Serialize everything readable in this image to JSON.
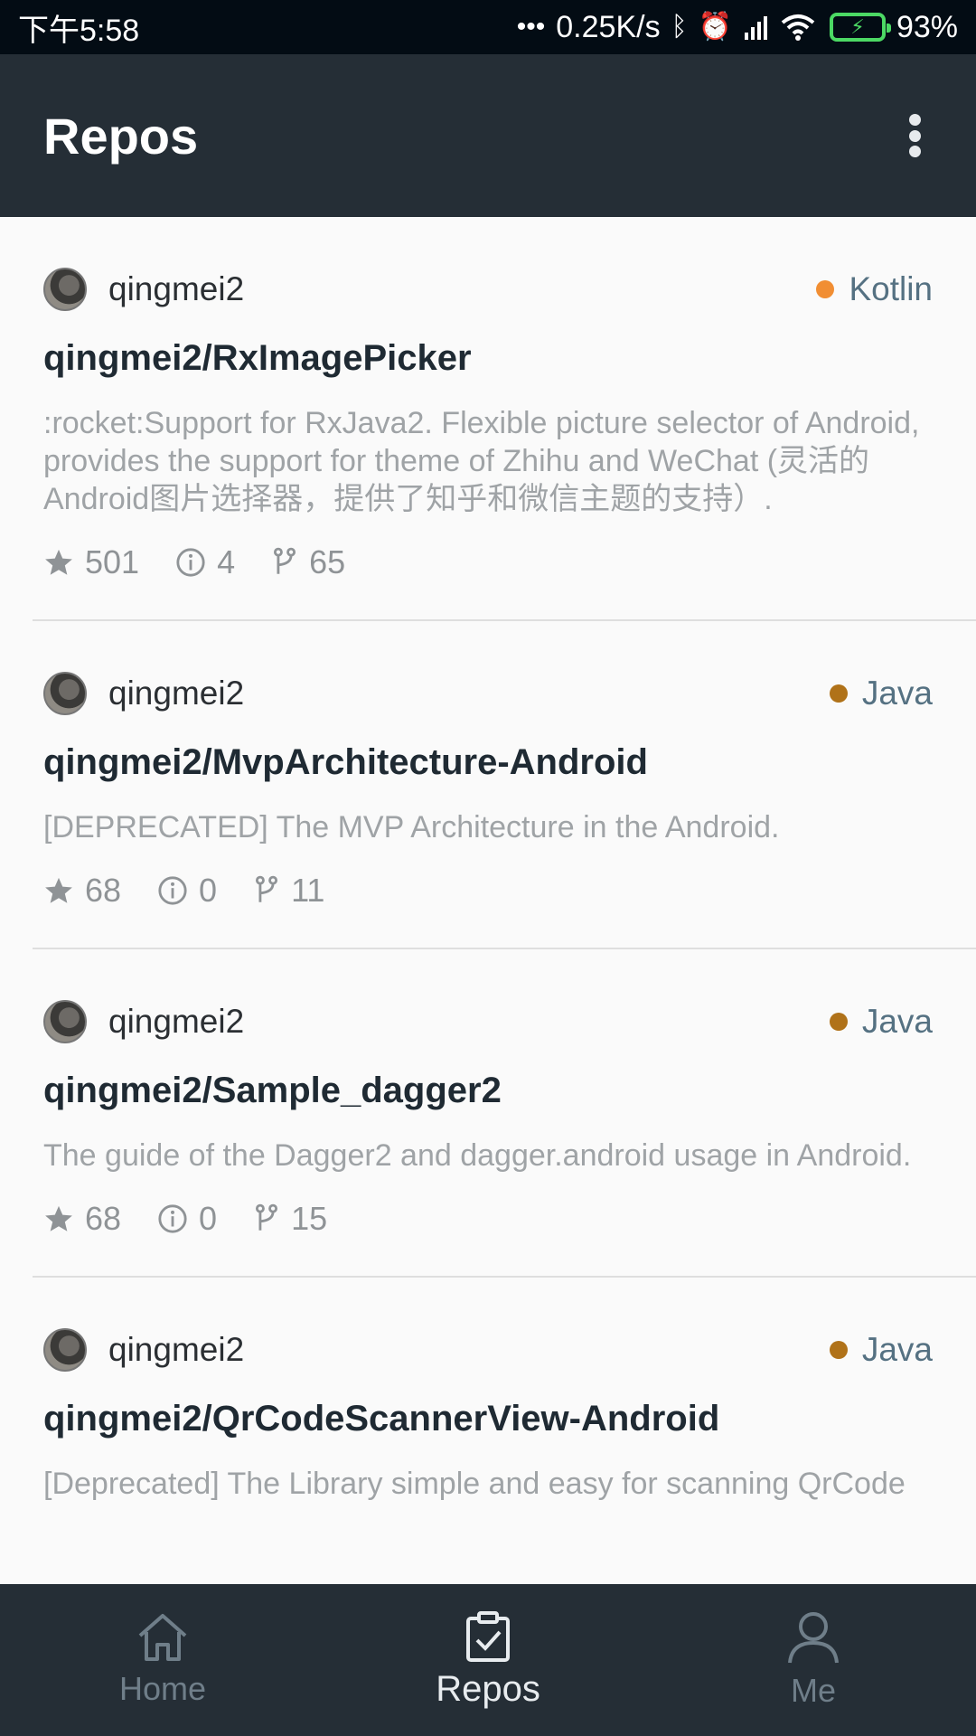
{
  "status_bar": {
    "time": "下午5:58",
    "net_speed": "0.25K/s",
    "battery": "93%",
    "icons": [
      "dots-icon",
      "bluetooth-icon",
      "alarm-icon",
      "signal-icon",
      "wifi-icon",
      "battery-icon"
    ]
  },
  "app_bar": {
    "title": "Repos",
    "menu_icon": "more-vert-icon"
  },
  "repos": [
    {
      "owner": "qingmei2",
      "language": "Kotlin",
      "language_color": "#f18e33",
      "name": "qingmei2/RxImagePicker",
      "description": ":rocket:Support for RxJava2. Flexible picture selector of Android, provides the support for theme of Zhihu and WeChat (灵活的Android图片选择器，提供了知乎和微信主题的支持）.",
      "stars": "501",
      "issues": "4",
      "forks": "65"
    },
    {
      "owner": "qingmei2",
      "language": "Java",
      "language_color": "#b07219",
      "name": "qingmei2/MvpArchitecture-Android",
      "description": "[DEPRECATED] The MVP Architecture in the Android.",
      "stars": "68",
      "issues": "0",
      "forks": "11"
    },
    {
      "owner": "qingmei2",
      "language": "Java",
      "language_color": "#b07219",
      "name": "qingmei2/Sample_dagger2",
      "description": "The guide of the Dagger2 and dagger.android usage in Android.",
      "stars": "68",
      "issues": "0",
      "forks": "15"
    },
    {
      "owner": "qingmei2",
      "language": "Java",
      "language_color": "#b07219",
      "name": "qingmei2/QrCodeScannerView-Android",
      "description": "[Deprecated] The Library simple and easy for scanning QrCode",
      "stars": "",
      "issues": "",
      "forks": ""
    }
  ],
  "bottom_nav": {
    "items": [
      {
        "label": "Home",
        "icon": "home-icon",
        "active": false
      },
      {
        "label": "Repos",
        "icon": "clipboard-check-icon",
        "active": true
      },
      {
        "label": "Me",
        "icon": "person-icon",
        "active": false
      }
    ]
  }
}
